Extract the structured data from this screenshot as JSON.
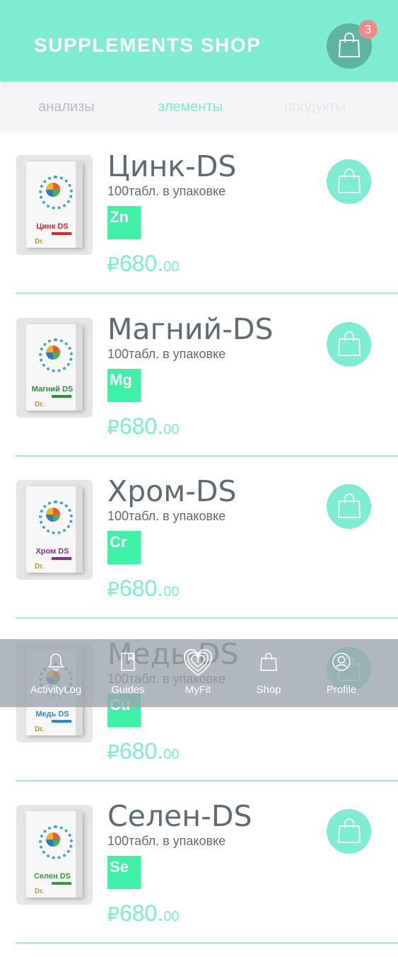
{
  "header": {
    "title": "SUPPLEMENTS SHOP",
    "cart_count": "3"
  },
  "tabs": [
    "анализы",
    "элементы",
    "продукты"
  ],
  "products": [
    {
      "name": "Цинк-DS",
      "pack": "100табл. в упаковке",
      "symbol": "Zn",
      "box_label": "Цинк DS",
      "box_color": "#d62b2b",
      "currency": "₽",
      "price_main": "680.",
      "price_dec": "00"
    },
    {
      "name": "Магний-DS",
      "pack": "100табл. в упаковке",
      "symbol": "Mg",
      "box_label": "Магний DS",
      "box_color": "#2f8a3a",
      "currency": "₽",
      "price_main": "680.",
      "price_dec": "00"
    },
    {
      "name": "Хром-DS",
      "pack": "100табл. в упаковке",
      "symbol": "Cr",
      "box_label": "Хром DS",
      "box_color": "#8a2f8f",
      "currency": "₽",
      "price_main": "680.",
      "price_dec": "00"
    },
    {
      "name": "Медь-DS",
      "pack": "100табл. в упаковке",
      "symbol": "Cu",
      "box_label": "Медь DS",
      "box_color": "#2f89c9",
      "currency": "₽",
      "price_main": "680.",
      "price_dec": "00"
    },
    {
      "name": "Селен-DS",
      "pack": "100табл. в упаковке",
      "symbol": "Se",
      "box_label": "Селен DS",
      "box_color": "#2f9a43",
      "currency": "₽",
      "price_main": "680.",
      "price_dec": "00"
    }
  ],
  "nav": [
    {
      "label": "ActivityLog",
      "icon": "bell-icon"
    },
    {
      "label": "Guides",
      "icon": "book-icon"
    },
    {
      "label": "MyFit",
      "icon": "heart-fingerprint-icon"
    },
    {
      "label": "Shop",
      "icon": "shopping-bag-icon"
    },
    {
      "label": "Profile",
      "icon": "user-icon"
    }
  ],
  "colors": {
    "accent": "#7eebd3",
    "symbol_bg": "#3ff2a7",
    "badge": "#f18a8a",
    "text": "#5d6b73"
  }
}
